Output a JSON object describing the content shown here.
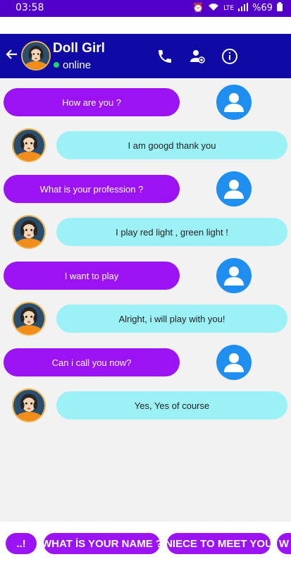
{
  "status": {
    "time": "03:58",
    "battery": "%69",
    "network": "LTE"
  },
  "header": {
    "name": "Doll Girl",
    "status": "online"
  },
  "messages": [
    {
      "user": "How are you ?",
      "bot": "I am googd thank you"
    },
    {
      "user": "What is your profession ?",
      "bot": "I play red light , green light !"
    },
    {
      "user": "I want to play",
      "bot": "Alright, i will play with you!"
    },
    {
      "user": "Can i call you now?",
      "bot": "Yes, Yes of course"
    }
  ],
  "suggestions": [
    "..!",
    "WHAT İS YOUR NAME ?",
    "NIECE TO MEET YOU",
    "W"
  ],
  "colors": {
    "header": "#0f0aa6",
    "user_bubble": "#9b12f5",
    "bot_bubble": "#9bf1f6",
    "avatar": "#1e8ff0"
  }
}
